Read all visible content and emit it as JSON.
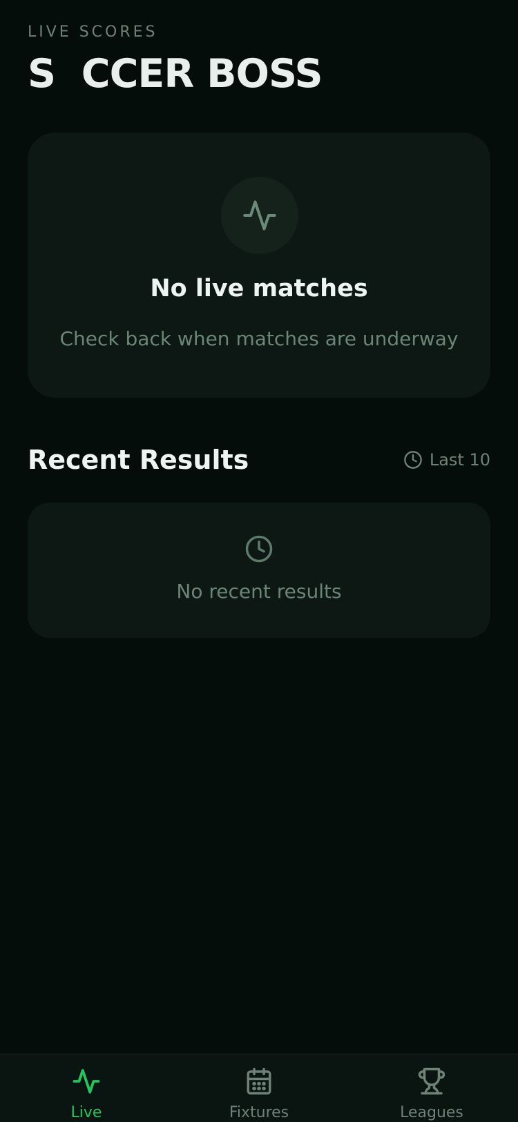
{
  "header": {
    "eyebrow": "LIVE SCORES",
    "title": "S  CCER BOSS"
  },
  "live_card": {
    "icon": "activity-icon",
    "title": "No live matches",
    "subtitle": "Check back when matches are underway"
  },
  "recent_results": {
    "title": "Recent Results",
    "filter_icon": "clock-icon",
    "filter_label": "Last 10",
    "empty_icon": "clock-icon",
    "empty_text": "No recent results"
  },
  "bottom_nav": {
    "items": [
      {
        "label": "Live",
        "icon": "activity-icon",
        "active": true
      },
      {
        "label": "Fixtures",
        "icon": "calendar-icon",
        "active": false
      },
      {
        "label": "Leagues",
        "icon": "trophy-icon",
        "active": false
      }
    ]
  },
  "colors": {
    "background": "#050d0a",
    "card": "#0d1814",
    "accent": "#22c55e",
    "muted": "#6e8278",
    "text": "#e8efec"
  }
}
